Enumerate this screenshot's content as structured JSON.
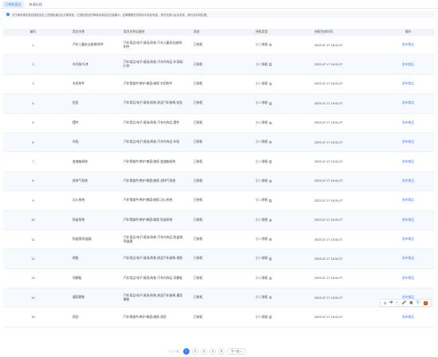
{
  "tabs": [
    {
      "label": "已授权类目",
      "active": true
    },
    {
      "label": "申请历程",
      "active": false
    }
  ],
  "notice": {
    "icon": "info-icon",
    "text": "关于新申请的类目授权会在上述授权通过后才能获批。已授权类目的审核标准会在页面展示；如果需要在同类目中发布商品，请先完成认证后发布，我们会尽快处理。"
  },
  "table": {
    "headers": {
      "no": "编号",
      "name": "类目名称",
      "path": "类目名称全路径",
      "status": "状态",
      "type": "授权类型",
      "time": "授权完成时间",
      "op": "操作"
    },
    "rows": [
      {
        "no": "1",
        "name": "汽车儿童安全座椅/附件",
        "path": "汽车用品/电子/清洗/改装-汽车儿童安全座椅/附件",
        "status": "已授权",
        "type": "小二授权",
        "time": "2023-07-17 16:31:27",
        "op": "发布商品"
      },
      {
        "no": "2",
        "name": "车顶架/行李",
        "path": "汽车用品/电子/清洗/改装-汽车外饰品-车顶架/行李",
        "status": "已授权",
        "type": "小二授权",
        "time": "2023-07-17 16:31:27",
        "op": "发布商品"
      },
      {
        "no": "3",
        "name": "车用附件",
        "path": "汽车零部件/养护/美容/维保-车用附件",
        "status": "已授权",
        "type": "小二授权",
        "time": "2023-07-17 16:31:27",
        "op": "发布商品"
      },
      {
        "no": "4",
        "name": "挂坠",
        "path": "汽车用品/电子/清洗/改装-舒适汽车座椅-挂坠",
        "status": "已授权",
        "type": "小二授权",
        "time": "2023-07-17 16:31:27",
        "op": "发布商品"
      },
      {
        "no": "5",
        "name": "摆件",
        "path": "汽车用品/电子/清洗/改装-汽车内饰品-摆件",
        "status": "已授权",
        "type": "小二授权",
        "time": "2023-07-17 16:31:27",
        "op": "发布商品"
      },
      {
        "no": "6",
        "name": "车贴",
        "path": "汽车用品/电子/清洗/改装-汽车外饰品-车贴",
        "status": "已授权",
        "type": "小二授权",
        "time": "2023-07-17 16:31:27",
        "op": "发布商品"
      },
      {
        "no": "7",
        "name": "变速箱系统",
        "path": "汽车零部件/养护/美容/维保-变速箱系统",
        "status": "已授权",
        "type": "小二授权",
        "time": "2023-07-17 16:31:27",
        "op": "发布商品"
      },
      {
        "no": "8",
        "name": "进排气系统",
        "path": "汽车零部件/养护/美容/维保-进排气系统",
        "status": "已授权",
        "type": "小二授权",
        "time": "2023-07-17 16:31:27",
        "op": "发布商品"
      },
      {
        "no": "9",
        "name": "点火系统",
        "path": "汽车零部件/养护/美容/维保-点火系统",
        "status": "已授权",
        "type": "小二授权",
        "time": "2023-07-17 16:31:27",
        "op": "发布商品"
      },
      {
        "no": "10",
        "name": "防盗系统",
        "path": "汽车零部件/养护/美容/维保-防盗系统",
        "status": "已授权",
        "type": "小二授权",
        "time": "2023-07-17 16:31:27",
        "op": "发布商品"
      },
      {
        "no": "11",
        "name": "防盗锁/防盗器",
        "path": "汽车用品/电子/清洗/改装-汽车内饰品-防盗锁/防盗器",
        "status": "已授权",
        "type": "小二授权",
        "time": "2023-07-17 16:31:27",
        "op": "发布商品"
      },
      {
        "no": "12",
        "name": "地胶",
        "path": "汽车用品/电子/清洗/改装-舒适汽车座椅-地胶",
        "status": "已授权",
        "type": "小二授权",
        "time": "2023-07-17 16:31:27",
        "op": "发布商品"
      },
      {
        "no": "13",
        "name": "顶棚板",
        "path": "汽车用品/电子/清洗/改装-汽车内饰品-顶棚板",
        "status": "已授权",
        "type": "小二授权",
        "time": "2023-07-17 16:31:27",
        "op": "发布商品"
      },
      {
        "no": "14",
        "name": "通用脚垫",
        "path": "汽车用品/电子/清洗/改装-舒适汽车座椅-通用脚垫",
        "status": "已授权",
        "type": "小二授权",
        "time": "2023-07-17 16:31:27",
        "op": "发布商品"
      },
      {
        "no": "15",
        "name": "雨刮",
        "path": "汽车零部件/养护/美容/维保-雨刮",
        "status": "已授权",
        "type": "小二授权",
        "time": "2023-07-17 16:31:27",
        "op": "发布商品"
      }
    ]
  },
  "pagination": {
    "prev": "< 上一页",
    "pages": [
      "1",
      "2",
      "3",
      "4",
      "5"
    ],
    "current": "1",
    "next": "下一页 >"
  },
  "ime_toolbar": {
    "logo": "S",
    "items": [
      "中",
      "°,",
      "🎤",
      "▦",
      "👕"
    ],
    "check": "✓"
  },
  "colors": {
    "accent": "#3b7cff",
    "header_bg": "#f1f4f9",
    "stripe_bg": "#f6f9fd"
  }
}
